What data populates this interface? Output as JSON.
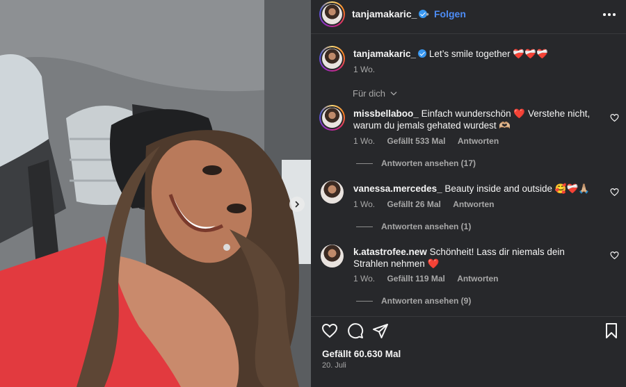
{
  "header": {
    "username": "tanjamakaric_",
    "separator": "•",
    "follow_label": "Folgen",
    "more_icon": "more-horizontal-icon"
  },
  "caption": {
    "username": "tanjamakaric_",
    "text": "Let’s smile together ❤️‍🩹❤️‍🩹❤️‍🩹",
    "time": "1 Wo."
  },
  "sort_label": "Für dich",
  "comments": [
    {
      "username": "missbellaboo_",
      "text": "Einfach wunderschön ❤️ Verstehe nicht, warum du jemals gehated wurdest 🫶🏼",
      "time": "1 Wo.",
      "likes": "Gefällt 533 Mal",
      "reply_label": "Antworten",
      "view_replies": "Antworten ansehen (17)"
    },
    {
      "username": "vanessa.mercedes_",
      "text": "Beauty inside and outside 🥰❤️‍🩹🙏🏼",
      "time": "1 Wo.",
      "likes": "Gefällt 26 Mal",
      "reply_label": "Antworten",
      "view_replies": "Antworten ansehen (1)"
    },
    {
      "username": "k.atastrofee.new",
      "text": "Schönheit! Lass dir niemals dein Strahlen nehmen ❤️",
      "time": "1 Wo.",
      "likes": "Gefällt 119 Mal",
      "reply_label": "Antworten",
      "view_replies": "Antworten ansehen (9)"
    }
  ],
  "footer": {
    "likes": "Gefällt 60.630 Mal",
    "date": "20. Juli"
  },
  "colors": {
    "panel_bg": "#27282b",
    "link_blue": "#4d8cf5",
    "verified_blue": "#3897f0",
    "muted": "#a8a8a8"
  }
}
